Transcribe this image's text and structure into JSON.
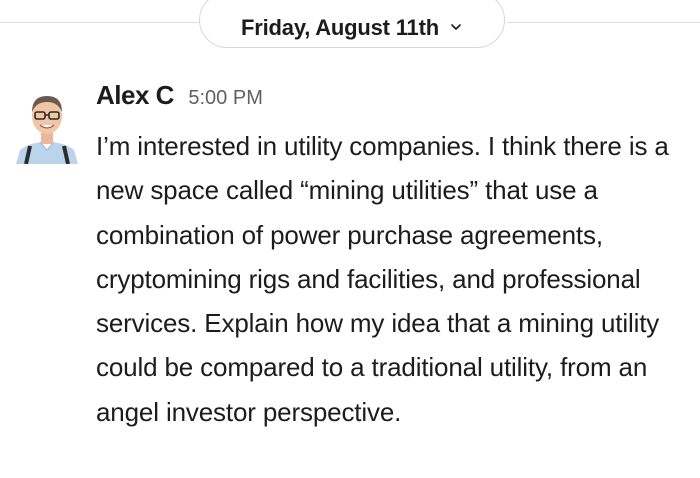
{
  "date_divider": {
    "label": "Friday, August 11th",
    "icon": "chevron-down-icon"
  },
  "message": {
    "author": "Alex C",
    "timestamp": "5:00 PM",
    "avatar_icon": "avatar-photo",
    "text": "I’m interested in utility companies. I think there is a new space called “mining utilities” that use a combination of power purchase agreements, cryptomining rigs and facilities, and professional services. Explain how my idea that a mining utility could be compared to a traditional utility, from an angel investor perspective."
  },
  "colors": {
    "text": "#1d1c1d",
    "timestamp": "#616061",
    "divider": "#dddddd",
    "background": "#ffffff"
  }
}
